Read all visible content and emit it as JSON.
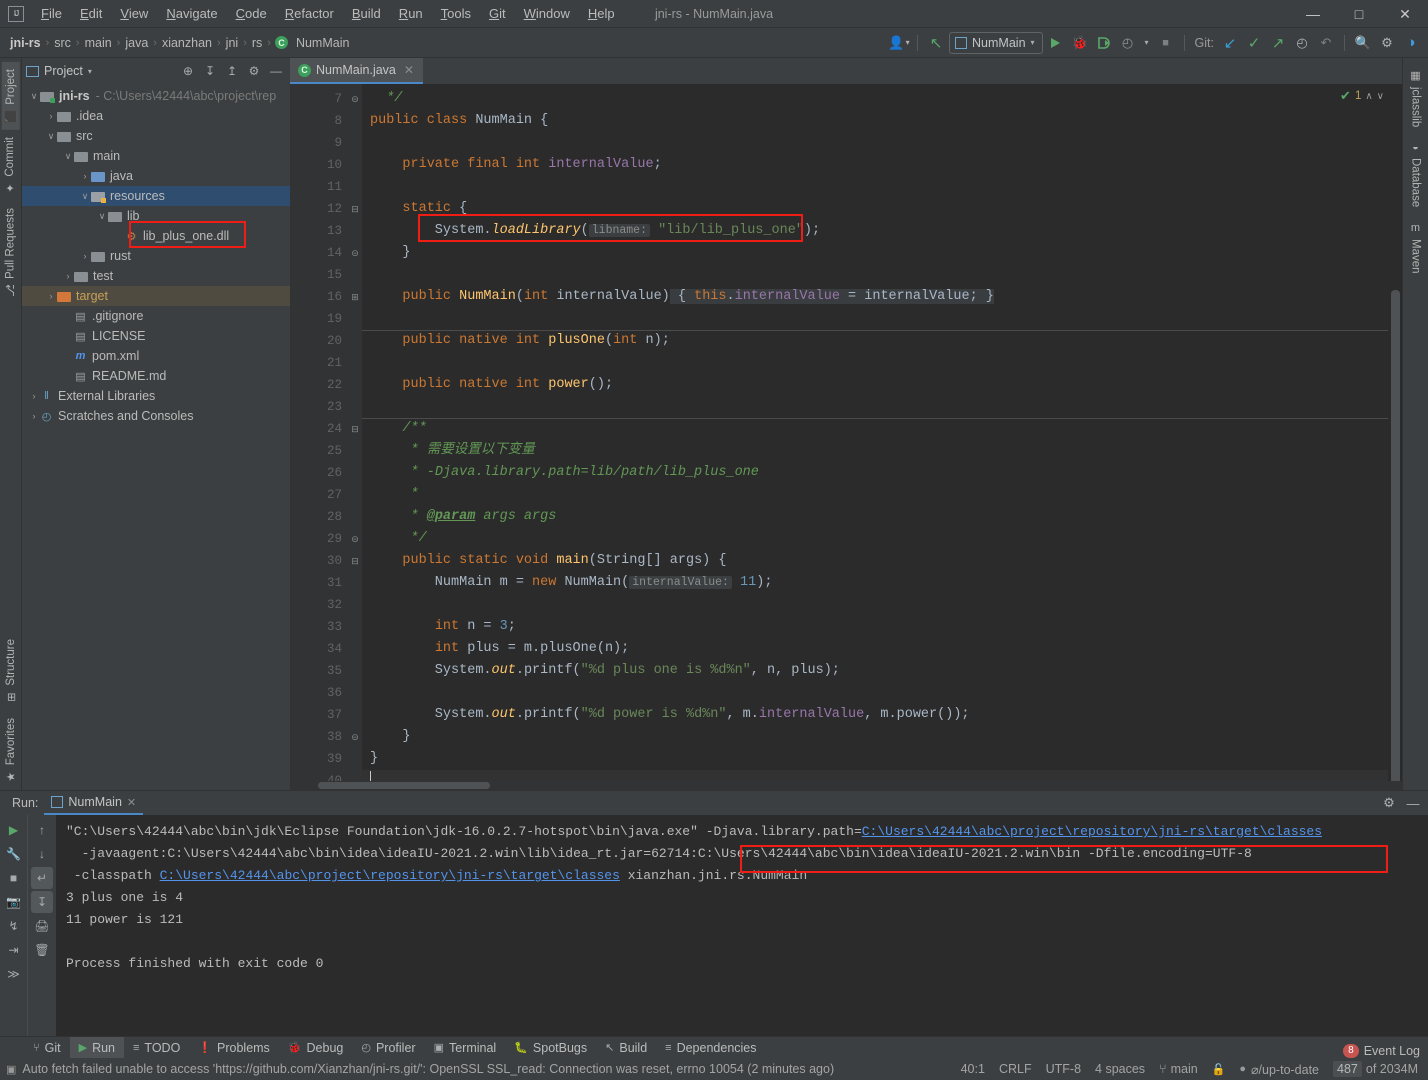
{
  "window": {
    "title": "jni-rs - NumMain.java",
    "logo": "IJ",
    "minimize": "—",
    "maximize": "□",
    "close": "✕"
  },
  "menu": [
    {
      "label": "File"
    },
    {
      "label": "Edit"
    },
    {
      "label": "View"
    },
    {
      "label": "Navigate"
    },
    {
      "label": "Code"
    },
    {
      "label": "Refactor"
    },
    {
      "label": "Build"
    },
    {
      "label": "Run"
    },
    {
      "label": "Tools"
    },
    {
      "label": "Git"
    },
    {
      "label": "Window"
    },
    {
      "label": "Help"
    }
  ],
  "breadcrumb": {
    "segments": [
      "jni-rs",
      "src",
      "main",
      "java",
      "xianzhan",
      "jni",
      "rs"
    ],
    "class_icon": "C",
    "class_name": "NumMain",
    "separator": "›"
  },
  "toolbar": {
    "user_icon": "👤",
    "user_caret": "▾",
    "build_icon": "↖",
    "run_config": "NumMain",
    "run_config_caret": "▾",
    "run_icon": "▶",
    "debug_icon": "🐞",
    "coverage_icon": "▶",
    "profile_icon": "◴",
    "profile_caret": "▾",
    "stop_icon": "■",
    "git_label": "Git:",
    "update_icon": "↙",
    "commit_icon": "✓",
    "push_icon": "↗",
    "history_icon": "◴",
    "rollback_icon": "↶",
    "search_icon": "🔍",
    "settings_icon": "⚙",
    "help_icon": "◑"
  },
  "left_strip": [
    {
      "label": "Project",
      "icon": "⬛",
      "active": true
    },
    {
      "label": "Commit",
      "icon": "✦",
      "active": false
    },
    {
      "label": "Pull Requests",
      "icon": "⎇",
      "active": false
    }
  ],
  "left_strip_bottom": [
    {
      "label": "Structure",
      "icon": "⊞"
    },
    {
      "label": "Favorites",
      "icon": "★"
    }
  ],
  "right_strip": [
    {
      "label": "jclasslib",
      "icon": "▦"
    },
    {
      "label": "Database",
      "icon": "◒"
    },
    {
      "label": "Maven",
      "icon": "m"
    }
  ],
  "project_panel": {
    "title": "Project",
    "title_caret": "▾",
    "icons": [
      "⊕",
      "↧",
      "↥",
      "⚙",
      "—"
    ],
    "tree": [
      {
        "indent": 0,
        "arrow": "∨",
        "type": "folder-module",
        "label": "jni-rs",
        "bold": true,
        "path": "- C:\\Users\\42444\\abc\\project\\rep",
        "selected": false
      },
      {
        "indent": 1,
        "arrow": "›",
        "type": "folder",
        "label": ".idea",
        "bold": false,
        "selected": false
      },
      {
        "indent": 1,
        "arrow": "∨",
        "type": "folder",
        "label": "src",
        "bold": false,
        "selected": false
      },
      {
        "indent": 2,
        "arrow": "∨",
        "type": "folder",
        "label": "main",
        "bold": false,
        "selected": false
      },
      {
        "indent": 3,
        "arrow": "›",
        "type": "folder-src",
        "label": "java",
        "bold": false,
        "selected": false
      },
      {
        "indent": 3,
        "arrow": "∨",
        "type": "folder-res",
        "label": "resources",
        "bold": false,
        "selected": true
      },
      {
        "indent": 4,
        "arrow": "∨",
        "type": "folder",
        "label": "lib",
        "bold": false,
        "selected": false
      },
      {
        "indent": 5,
        "arrow": "",
        "type": "file-dll",
        "label": "lib_plus_one.dll",
        "bold": false,
        "selected": false
      },
      {
        "indent": 3,
        "arrow": "›",
        "type": "folder",
        "label": "rust",
        "bold": false,
        "selected": false
      },
      {
        "indent": 2,
        "arrow": "›",
        "type": "folder",
        "label": "test",
        "bold": false,
        "selected": false
      },
      {
        "indent": 1,
        "arrow": "›",
        "type": "folder-target",
        "label": "target",
        "bold": false,
        "selected": false,
        "highlight": true
      },
      {
        "indent": 2,
        "arrow": "",
        "type": "file-gitignore",
        "label": ".gitignore",
        "bold": false,
        "selected": false
      },
      {
        "indent": 2,
        "arrow": "",
        "type": "file-license",
        "label": "LICENSE",
        "bold": false,
        "selected": false
      },
      {
        "indent": 2,
        "arrow": "",
        "type": "file-pom",
        "label": "pom.xml",
        "bold": false,
        "selected": false
      },
      {
        "indent": 2,
        "arrow": "",
        "type": "file-md",
        "label": "README.md",
        "bold": false,
        "selected": false
      },
      {
        "indent": 0,
        "arrow": "›",
        "type": "libs",
        "label": "External Libraries",
        "bold": false,
        "selected": false
      },
      {
        "indent": 0,
        "arrow": "›",
        "type": "scratches",
        "label": "Scratches and Consoles",
        "bold": false,
        "selected": false
      }
    ]
  },
  "editor": {
    "tab": {
      "label": "NumMain.java",
      "icon": "C",
      "close": "✕"
    },
    "inspection": {
      "icon": "✔",
      "count": "1",
      "up": "∧",
      "down": "∨"
    },
    "first_line": 7,
    "lines": [
      {
        "num": 7,
        "mark": "",
        "fold": "⊝",
        "html": "  <span class=\"cm\">*/</span>"
      },
      {
        "num": 8,
        "mark": "▶",
        "fold": "",
        "html": "<span class=\"kw\">public class</span> <span class=\"cls\">NumMain</span> {"
      },
      {
        "num": 9,
        "mark": "",
        "fold": "",
        "html": ""
      },
      {
        "num": 10,
        "mark": "",
        "fold": "",
        "html": "    <span class=\"kw\">private final int</span> <span class=\"fld\">internalValue</span>;"
      },
      {
        "num": 11,
        "mark": "",
        "fold": "",
        "html": ""
      },
      {
        "num": 12,
        "mark": "",
        "fold": "⊟",
        "html": "    <span class=\"kw\">static</span> {"
      },
      {
        "num": 13,
        "mark": "",
        "fold": "",
        "html": "        System.<span class=\"sta\">loadLibrary</span>(<span class=\"hint\">libname:</span> <span class=\"str\">\"lib/lib_plus_one\"</span>);"
      },
      {
        "num": 14,
        "mark": "",
        "fold": "⊝",
        "html": "    }"
      },
      {
        "num": 15,
        "mark": "",
        "fold": "",
        "html": ""
      },
      {
        "num": 16,
        "mark": "",
        "fold": "⊞",
        "html": "    <span class=\"kw\">public</span> <span class=\"mth\">NumMain</span>(<span class=\"kw\">int</span> internalValue)<span class=\"lens\"> { <span class=\"kw\">this</span>.<span class=\"fld\">internalValue</span> = internalValue; }</span>"
      },
      {
        "num": 19,
        "mark": "",
        "fold": "",
        "html": ""
      },
      {
        "num": 20,
        "mark": "",
        "fold": "",
        "html": "    <span class=\"kw\">public native int</span> <span class=\"mth\">plusOne</span>(<span class=\"kw\">int</span> n);"
      },
      {
        "num": 21,
        "mark": "",
        "fold": "",
        "html": ""
      },
      {
        "num": 22,
        "mark": "",
        "fold": "",
        "html": "    <span class=\"kw\">public native int</span> <span class=\"mth\">power</span>();"
      },
      {
        "num": 23,
        "mark": "",
        "fold": "",
        "html": ""
      },
      {
        "num": 24,
        "mark": "",
        "fold": "⊟",
        "html": "    <span class=\"cm\">/**</span>"
      },
      {
        "num": 25,
        "mark": "",
        "fold": "",
        "html": "     <span class=\"cm\">* 需要设置以下变量</span>"
      },
      {
        "num": 26,
        "mark": "",
        "fold": "",
        "html": "     <span class=\"cm\">* -Djava.library.path=lib/path/lib_plus_one</span>"
      },
      {
        "num": 27,
        "mark": "",
        "fold": "",
        "html": "     <span class=\"cm\">*</span>"
      },
      {
        "num": 28,
        "mark": "",
        "fold": "",
        "html": "     <span class=\"cm\">* </span><span class=\"cmtag\">@param</span><span class=\"cm\"> args args</span>"
      },
      {
        "num": 29,
        "mark": "",
        "fold": "⊝",
        "html": "     <span class=\"cm\">*/</span>"
      },
      {
        "num": 30,
        "mark": "▶",
        "fold": "⊟",
        "html": "    <span class=\"kw\">public static void</span> <span class=\"mth\">main</span>(String[] args) {"
      },
      {
        "num": 31,
        "mark": "",
        "fold": "",
        "html": "        NumMain m = <span class=\"kw\">new</span> <span class=\"cls\">NumMain</span>(<span class=\"hint\">internalValue:</span> <span class=\"num\">11</span>);"
      },
      {
        "num": 32,
        "mark": "",
        "fold": "",
        "html": ""
      },
      {
        "num": 33,
        "mark": "",
        "fold": "",
        "html": "        <span class=\"kw\">int</span> n = <span class=\"num\">3</span>;"
      },
      {
        "num": 34,
        "mark": "",
        "fold": "",
        "html": "        <span class=\"kw\">int</span> plus = m.plusOne(n);"
      },
      {
        "num": 35,
        "mark": "",
        "fold": "",
        "html": "        System.<span class=\"sta\">out</span>.printf(<span class=\"str\">\"%d plus one is %d%n\"</span>, n, plus);"
      },
      {
        "num": 36,
        "mark": "",
        "fold": "",
        "html": ""
      },
      {
        "num": 37,
        "mark": "",
        "fold": "",
        "html": "        System.<span class=\"sta\">out</span>.printf(<span class=\"str\">\"%d power is %d%n\"</span>, m.<span class=\"fld\">internalValue</span>, m.power());"
      },
      {
        "num": 38,
        "mark": "",
        "fold": "⊝",
        "html": "    }"
      },
      {
        "num": 39,
        "mark": "",
        "fold": "",
        "html": "}"
      },
      {
        "num": 40,
        "mark": "",
        "fold": "",
        "html": "<span class=\"caret\"></span>",
        "current": true
      }
    ]
  },
  "run_window": {
    "label": "Run:",
    "tab": "NumMain",
    "tab_close": "✕",
    "settings_icon": "⚙",
    "hide_icon": "—",
    "side_icons": [
      "▶",
      "🔧",
      "■",
      "📷",
      "↯",
      "⇥",
      "≫"
    ],
    "side_icons2": [
      "↑",
      "↓",
      "↵",
      "↧",
      "🖨",
      "🗑"
    ],
    "console": [
      {
        "parts": [
          {
            "t": "\"C:\\Users\\42444\\abc\\bin\\jdk\\Eclipse Foundation\\jdk-16.0.2.7-hotspot\\bin\\java.exe\" ",
            "k": "plain"
          },
          {
            "t": "-Djava.library.path=",
            "k": "plain"
          },
          {
            "t": "C:\\Users\\42444\\abc\\project\\repository\\jni-rs\\target\\classes",
            "k": "link"
          }
        ]
      },
      {
        "parts": [
          {
            "t": "  -javaagent:C:\\Users\\42444\\abc\\bin\\idea\\ideaIU-2021.2.win\\lib\\idea_rt.jar=62714:C:\\Users\\42444\\abc\\bin\\idea\\ideaIU-2021.2.win\\bin -Dfile.encoding=UTF-8",
            "k": "plain"
          }
        ]
      },
      {
        "parts": [
          {
            "t": " -classpath ",
            "k": "plain"
          },
          {
            "t": "C:\\Users\\42444\\abc\\project\\repository\\jni-rs\\target\\classes",
            "k": "link"
          },
          {
            "t": " xianzhan.jni.rs.NumMain",
            "k": "plain"
          }
        ]
      },
      {
        "parts": [
          {
            "t": "3 plus one is 4",
            "k": "plain"
          }
        ]
      },
      {
        "parts": [
          {
            "t": "11 power is 121",
            "k": "plain"
          }
        ]
      },
      {
        "parts": [
          {
            "t": "",
            "k": "plain"
          }
        ]
      },
      {
        "parts": [
          {
            "t": "Process finished with exit code 0",
            "k": "plain"
          }
        ]
      }
    ]
  },
  "bottom_tabs": [
    {
      "label": "Git",
      "icon": "⑂",
      "active": false
    },
    {
      "label": "Run",
      "icon": "▶",
      "active": true
    },
    {
      "label": "TODO",
      "icon": "≡",
      "active": false
    },
    {
      "label": "Problems",
      "icon": "❗",
      "active": false
    },
    {
      "label": "Debug",
      "icon": "🐞",
      "active": false
    },
    {
      "label": "Profiler",
      "icon": "◴",
      "active": false
    },
    {
      "label": "Terminal",
      "icon": "▣",
      "active": false
    },
    {
      "label": "SpotBugs",
      "icon": "🐛",
      "active": false
    },
    {
      "label": "Build",
      "icon": "↖",
      "active": false
    },
    {
      "label": "Dependencies",
      "icon": "≡",
      "active": false
    }
  ],
  "status_bar": {
    "icon": "▣",
    "message": "Auto fetch failed unable to access 'https://github.com/Xianzhan/jni-rs.git/': OpenSSL SSL_read: Connection was reset, errno 10054 (2 minutes ago)",
    "caret_position": "40:1",
    "line_separator": "CRLF",
    "encoding": "UTF-8",
    "indent": "4 spaces",
    "branch_icon": "⑂",
    "branch": "main",
    "lock_icon": "🔓",
    "sync_icon": "●",
    "sync_status": "⌀/up-to-date",
    "memory_used": "487",
    "memory_total": "of 2034M"
  },
  "event_log": {
    "count": "8",
    "label": "Event Log"
  },
  "annotations": {
    "dll_box": "lib_plus_one.dll highlighted",
    "loadlibrary_box": "System.loadLibrary line highlighted",
    "djava_box": "-Djava.library.path argument highlighted"
  },
  "colors": {
    "accent": "#4a88c7",
    "annotation": "#f01c16",
    "selection": "#2f4e6f",
    "editor_bg": "#2b2b2b",
    "panel_bg": "#3c3f41"
  }
}
